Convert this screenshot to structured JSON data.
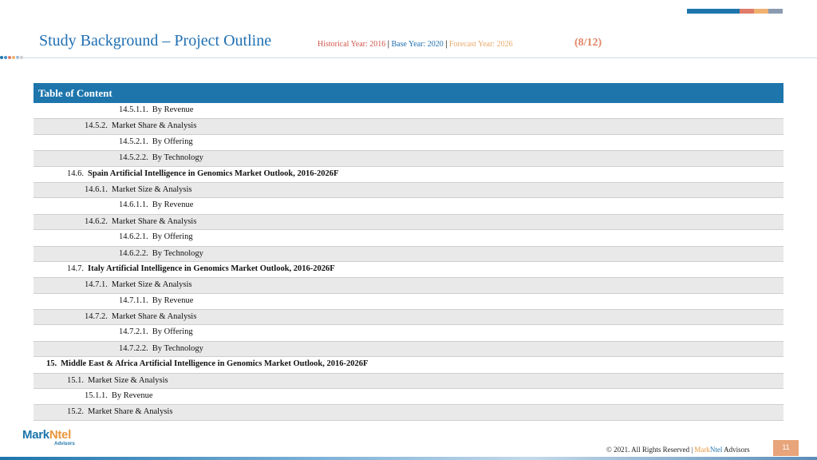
{
  "header": {
    "title": "Study Background – Project Outline",
    "meta_historical": "Historical Year: 2016",
    "meta_sep": " | ",
    "meta_base": "Base Year: 2020",
    "meta_forecast": "Forecast Year: 2026",
    "page_count": "(8/12)",
    "colors": {
      "historical": "#d0564b",
      "base": "#1f6fb2",
      "forecast": "#e8a86a",
      "title": "#1f6fb2",
      "accent": "#e08565"
    }
  },
  "toc": {
    "header": "Table of Content",
    "rows": [
      {
        "indent": "l4",
        "num": "14.5.1.1.",
        "label": "By Revenue",
        "bold": false
      },
      {
        "indent": "l3",
        "num": "14.5.2.",
        "label": "Market Share & Analysis",
        "bold": false
      },
      {
        "indent": "l4",
        "num": "14.5.2.1.",
        "label": "By Offering",
        "bold": false
      },
      {
        "indent": "l4",
        "num": "14.5.2.2.",
        "label": "By Technology",
        "bold": false
      },
      {
        "indent": "l2",
        "num": "14.6.",
        "label": "Spain Artificial Intelligence in Genomics Market Outlook, 2016-2026F",
        "bold": true
      },
      {
        "indent": "l3",
        "num": "14.6.1.",
        "label": "Market Size & Analysis",
        "bold": false
      },
      {
        "indent": "l4",
        "num": "14.6.1.1.",
        "label": "By Revenue",
        "bold": false
      },
      {
        "indent": "l3",
        "num": "14.6.2.",
        "label": "Market Share & Analysis",
        "bold": false
      },
      {
        "indent": "l4",
        "num": "14.6.2.1.",
        "label": "By Offering",
        "bold": false
      },
      {
        "indent": "l4",
        "num": "14.6.2.2.",
        "label": "By Technology",
        "bold": false
      },
      {
        "indent": "l2",
        "num": "14.7.",
        "label": "Italy Artificial Intelligence in Genomics Market Outlook, 2016-2026F",
        "bold": true
      },
      {
        "indent": "l3",
        "num": "14.7.1.",
        "label": "Market Size & Analysis",
        "bold": false
      },
      {
        "indent": "l4",
        "num": "14.7.1.1.",
        "label": "By Revenue",
        "bold": false
      },
      {
        "indent": "l3",
        "num": "14.7.2.",
        "label": "Market Share & Analysis",
        "bold": false
      },
      {
        "indent": "l4",
        "num": "14.7.2.1.",
        "label": "By Offering",
        "bold": false
      },
      {
        "indent": "l4",
        "num": "14.7.2.2.",
        "label": "By Technology",
        "bold": false
      },
      {
        "indent": "l1",
        "num": "15.",
        "label": "Middle East & Africa Artificial Intelligence in Genomics Market Outlook, 2016-2026F",
        "bold": true
      },
      {
        "indent": "l2",
        "num": "15.1.",
        "label": "Market Size & Analysis",
        "bold": false
      },
      {
        "indent": "l3",
        "num": "15.1.1.",
        "label": "By Revenue",
        "bold": false
      },
      {
        "indent": "l2",
        "num": "15.2.",
        "label": "Market Share & Analysis",
        "bold": false
      }
    ]
  },
  "logo": {
    "mark_a": "Mark",
    "mark_b": "Ntel",
    "sub": "Advisors"
  },
  "footer": {
    "copyright": "© 2021. All Rights Reserved | ",
    "brand_a": "Mark",
    "brand_b": "Ntel",
    "brand_c": " Advisors",
    "page_number": "11"
  }
}
